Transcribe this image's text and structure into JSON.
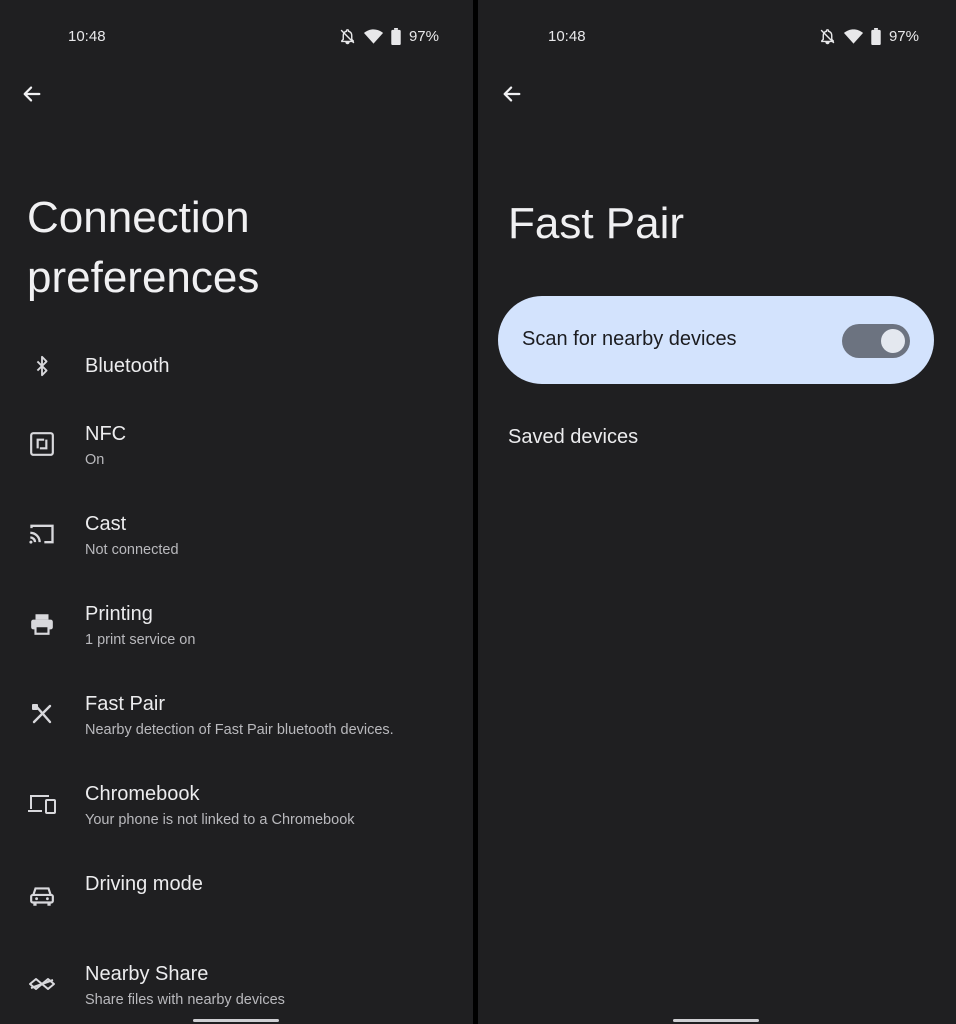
{
  "left": {
    "status": {
      "time": "10:48",
      "battery": "97%"
    },
    "title": "Connection preferences",
    "items": [
      {
        "icon": "bluetooth-icon",
        "title": "Bluetooth",
        "subtitle": ""
      },
      {
        "icon": "nfc-icon",
        "title": "NFC",
        "subtitle": "On"
      },
      {
        "icon": "cast-icon",
        "title": "Cast",
        "subtitle": "Not connected"
      },
      {
        "icon": "printer-icon",
        "title": "Printing",
        "subtitle": "1 print service on"
      },
      {
        "icon": "fast-pair-icon",
        "title": "Fast Pair",
        "subtitle": "Nearby detection of Fast Pair bluetooth devices."
      },
      {
        "icon": "devices-icon",
        "title": "Chromebook",
        "subtitle": "Your phone is not linked to a Chromebook"
      },
      {
        "icon": "car-icon",
        "title": "Driving mode",
        "subtitle": ""
      },
      {
        "icon": "nearby-share-icon",
        "title": "Nearby Share",
        "subtitle": "Share files with nearby devices"
      }
    ]
  },
  "right": {
    "status": {
      "time": "10:48",
      "battery": "97%"
    },
    "title": "Fast Pair",
    "scan_toggle": {
      "label": "Scan for nearby devices",
      "on": true
    },
    "saved_devices_label": "Saved devices"
  },
  "colors": {
    "background": "#1f1f21",
    "toggle_card": "#d3e3fd",
    "switch_track": "#6c7380"
  }
}
